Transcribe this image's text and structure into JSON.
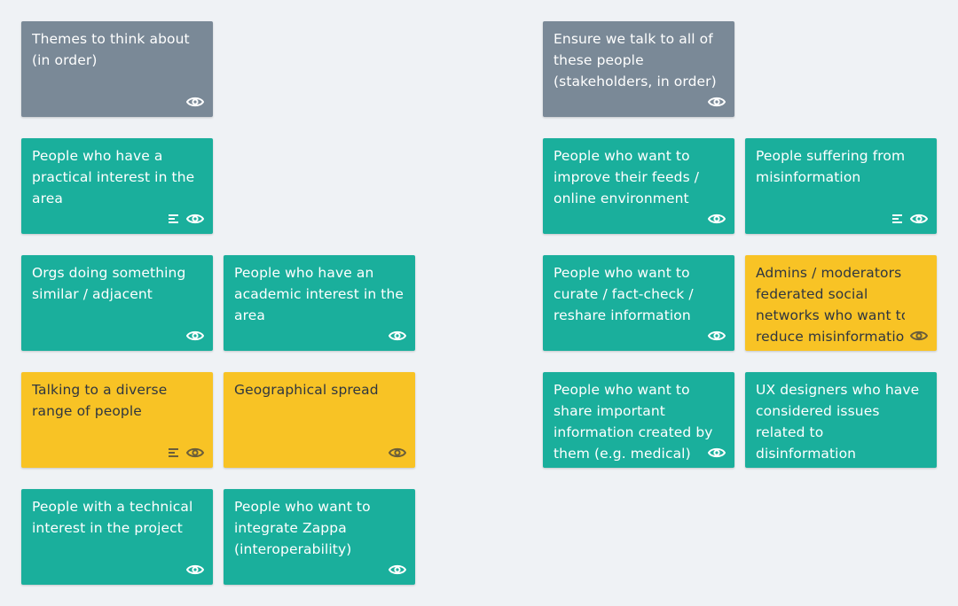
{
  "board": {
    "left_column_header": "Themes to think about (in order)",
    "right_column_header": "Ensure we talk to all of these people (stakeholders, in order)"
  },
  "cards": {
    "c1": {
      "lines": [
        "Themes to think about",
        "(in order)"
      ]
    },
    "c2": {
      "lines": [
        "Ensure we talk to all of",
        "these people",
        "(stakeholders, in order)"
      ]
    },
    "c3": {
      "lines": [
        "People who have a",
        "practical interest in the",
        "area"
      ]
    },
    "c4": {
      "lines": [
        "People who want to",
        "improve their feeds /",
        "online environment"
      ]
    },
    "c5": {
      "lines": [
        "People suffering from",
        "misinformation"
      ]
    },
    "c6": {
      "lines": [
        "Orgs doing something",
        "similar / adjacent"
      ]
    },
    "c7": {
      "lines": [
        "People who have an",
        "academic interest in the",
        "area"
      ]
    },
    "c8": {
      "lines": [
        "People who want to",
        "curate / fact-check /",
        "reshare information"
      ]
    },
    "c9": {
      "lines": [
        "Admins / moderators of",
        "federated social",
        "networks who want to",
        "reduce misinformatio"
      ]
    },
    "c10": {
      "lines": [
        "Talking to a diverse",
        "range of people"
      ]
    },
    "c11": {
      "lines": [
        "Geographical spread"
      ]
    },
    "c12": {
      "lines": [
        "People who want to",
        "share important",
        "information created by",
        "them (e.g. medical)"
      ]
    },
    "c13": {
      "lines": [
        "UX designers who have",
        "considered issues",
        "related to",
        "disinformation"
      ]
    },
    "c14": {
      "lines": [
        "People with a technical",
        "interest in the project"
      ]
    },
    "c15": {
      "lines": [
        "People who want to",
        "integrate Zappa",
        "(interoperability)"
      ]
    }
  },
  "icons": {
    "watch": "eye-icon",
    "description": "description-lines-icon"
  },
  "colors": {
    "background": "#eff2f5",
    "gray_card": "#7a8997",
    "teal_card": "#1aaf9c",
    "yellow_card": "#f8c325"
  }
}
